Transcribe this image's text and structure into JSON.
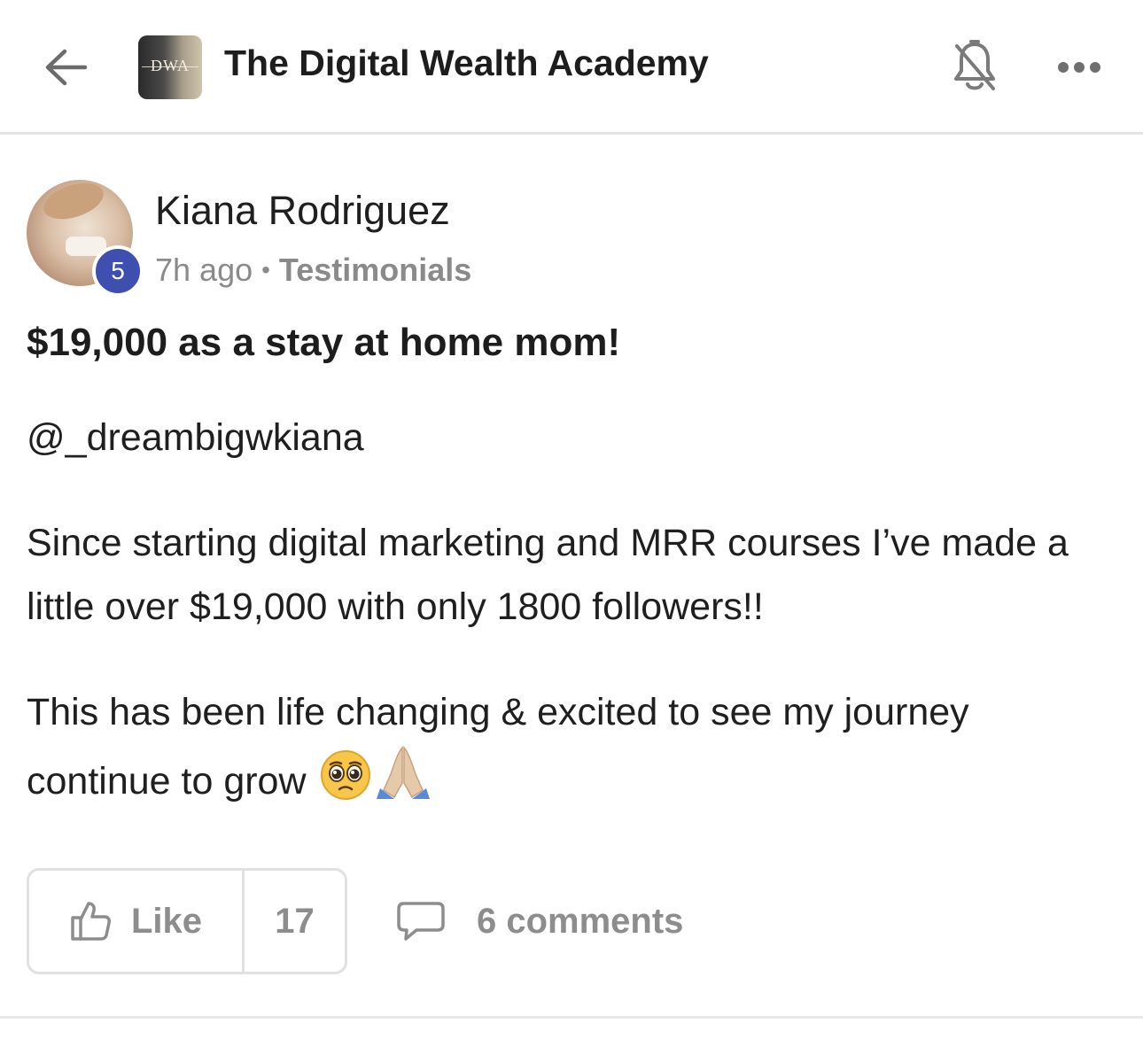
{
  "header": {
    "back_icon": "arrow-left-icon",
    "logo_text": "DWA",
    "group_title": "The Digital Wealth Academy",
    "bell_icon": "bell-off-icon",
    "more_icon": "more-horizontal-icon"
  },
  "post": {
    "author": {
      "name": "Kiana Rodriguez",
      "level": "5",
      "level_color": "#3e4fb0"
    },
    "time_ago": "7h ago",
    "separator": "•",
    "category": "Testimonials",
    "title": "$19,000 as a stay at home mom!",
    "mention": "@_dreambigwkiana",
    "paragraph_1": "Since starting digital marketing and MRR courses I’ve made a little over $19,000 with only 1800 followers!!",
    "paragraph_2": "This has been life changing & excited to see my journey continue to grow",
    "emojis": [
      "pleading-face-emoji",
      "folded-hands-emoji"
    ]
  },
  "actions": {
    "like_label": "Like",
    "like_count": "17",
    "like_icon": "thumbs-up-icon",
    "comments_label": "6 comments",
    "comment_icon": "comment-bubble-icon"
  }
}
